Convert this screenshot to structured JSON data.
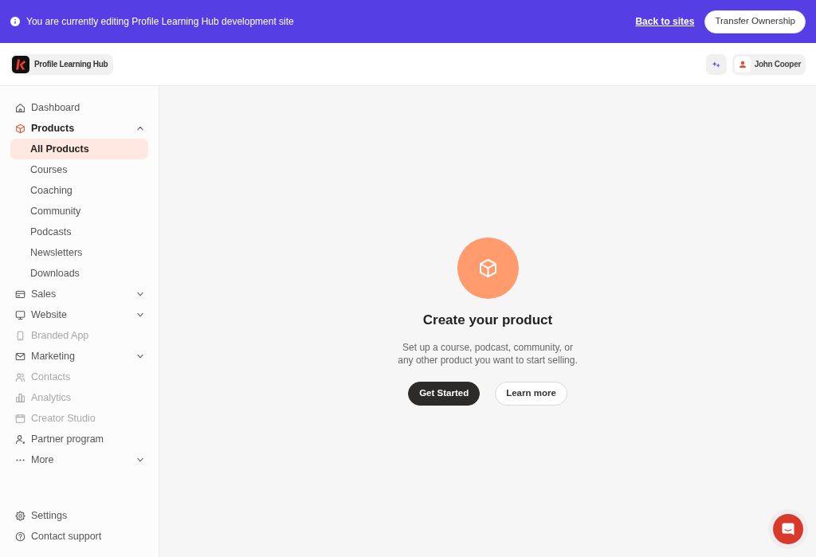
{
  "banner": {
    "message": "You are currently editing Profile Learning Hub development site",
    "link": "Back to sites",
    "button": "Transfer Ownership"
  },
  "header": {
    "site_name": "Profile Learning Hub",
    "user_name": "John Cooper"
  },
  "sidebar": {
    "items": [
      {
        "label": "Dashboard",
        "selected": false,
        "disabled": false
      },
      {
        "label": "Products",
        "selected": false,
        "disabled": false,
        "expanded": true,
        "children": [
          {
            "label": "All Products",
            "selected": true
          },
          {
            "label": "Courses",
            "selected": false
          },
          {
            "label": "Coaching",
            "selected": false
          },
          {
            "label": "Community",
            "selected": false
          },
          {
            "label": "Podcasts",
            "selected": false
          },
          {
            "label": "Newsletters",
            "selected": false
          },
          {
            "label": "Downloads",
            "selected": false
          }
        ]
      },
      {
        "label": "Sales",
        "selected": false,
        "disabled": false,
        "expanded": false
      },
      {
        "label": "Website",
        "selected": false,
        "disabled": false,
        "expanded": false
      },
      {
        "label": "Branded App",
        "selected": false,
        "disabled": true
      },
      {
        "label": "Marketing",
        "selected": false,
        "disabled": false,
        "expanded": false
      },
      {
        "label": "Contacts",
        "selected": false,
        "disabled": true
      },
      {
        "label": "Analytics",
        "selected": false,
        "disabled": true
      },
      {
        "label": "Creator Studio",
        "selected": false,
        "disabled": true
      },
      {
        "label": "Partner program",
        "selected": false,
        "disabled": false
      },
      {
        "label": "More",
        "selected": false,
        "disabled": false,
        "expanded": false
      }
    ],
    "footer_items": [
      {
        "label": "Settings",
        "selected": false
      },
      {
        "label": "Contact support",
        "selected": false
      }
    ]
  },
  "empty_state": {
    "title": "Create your product",
    "description": [
      "Set up a course, podcast, community, or",
      "any other product you want to start selling."
    ],
    "buttons": [
      {
        "label": "Get Started",
        "kind": "primary"
      },
      {
        "label": "Learn more",
        "kind": "secondary"
      }
    ]
  }
}
